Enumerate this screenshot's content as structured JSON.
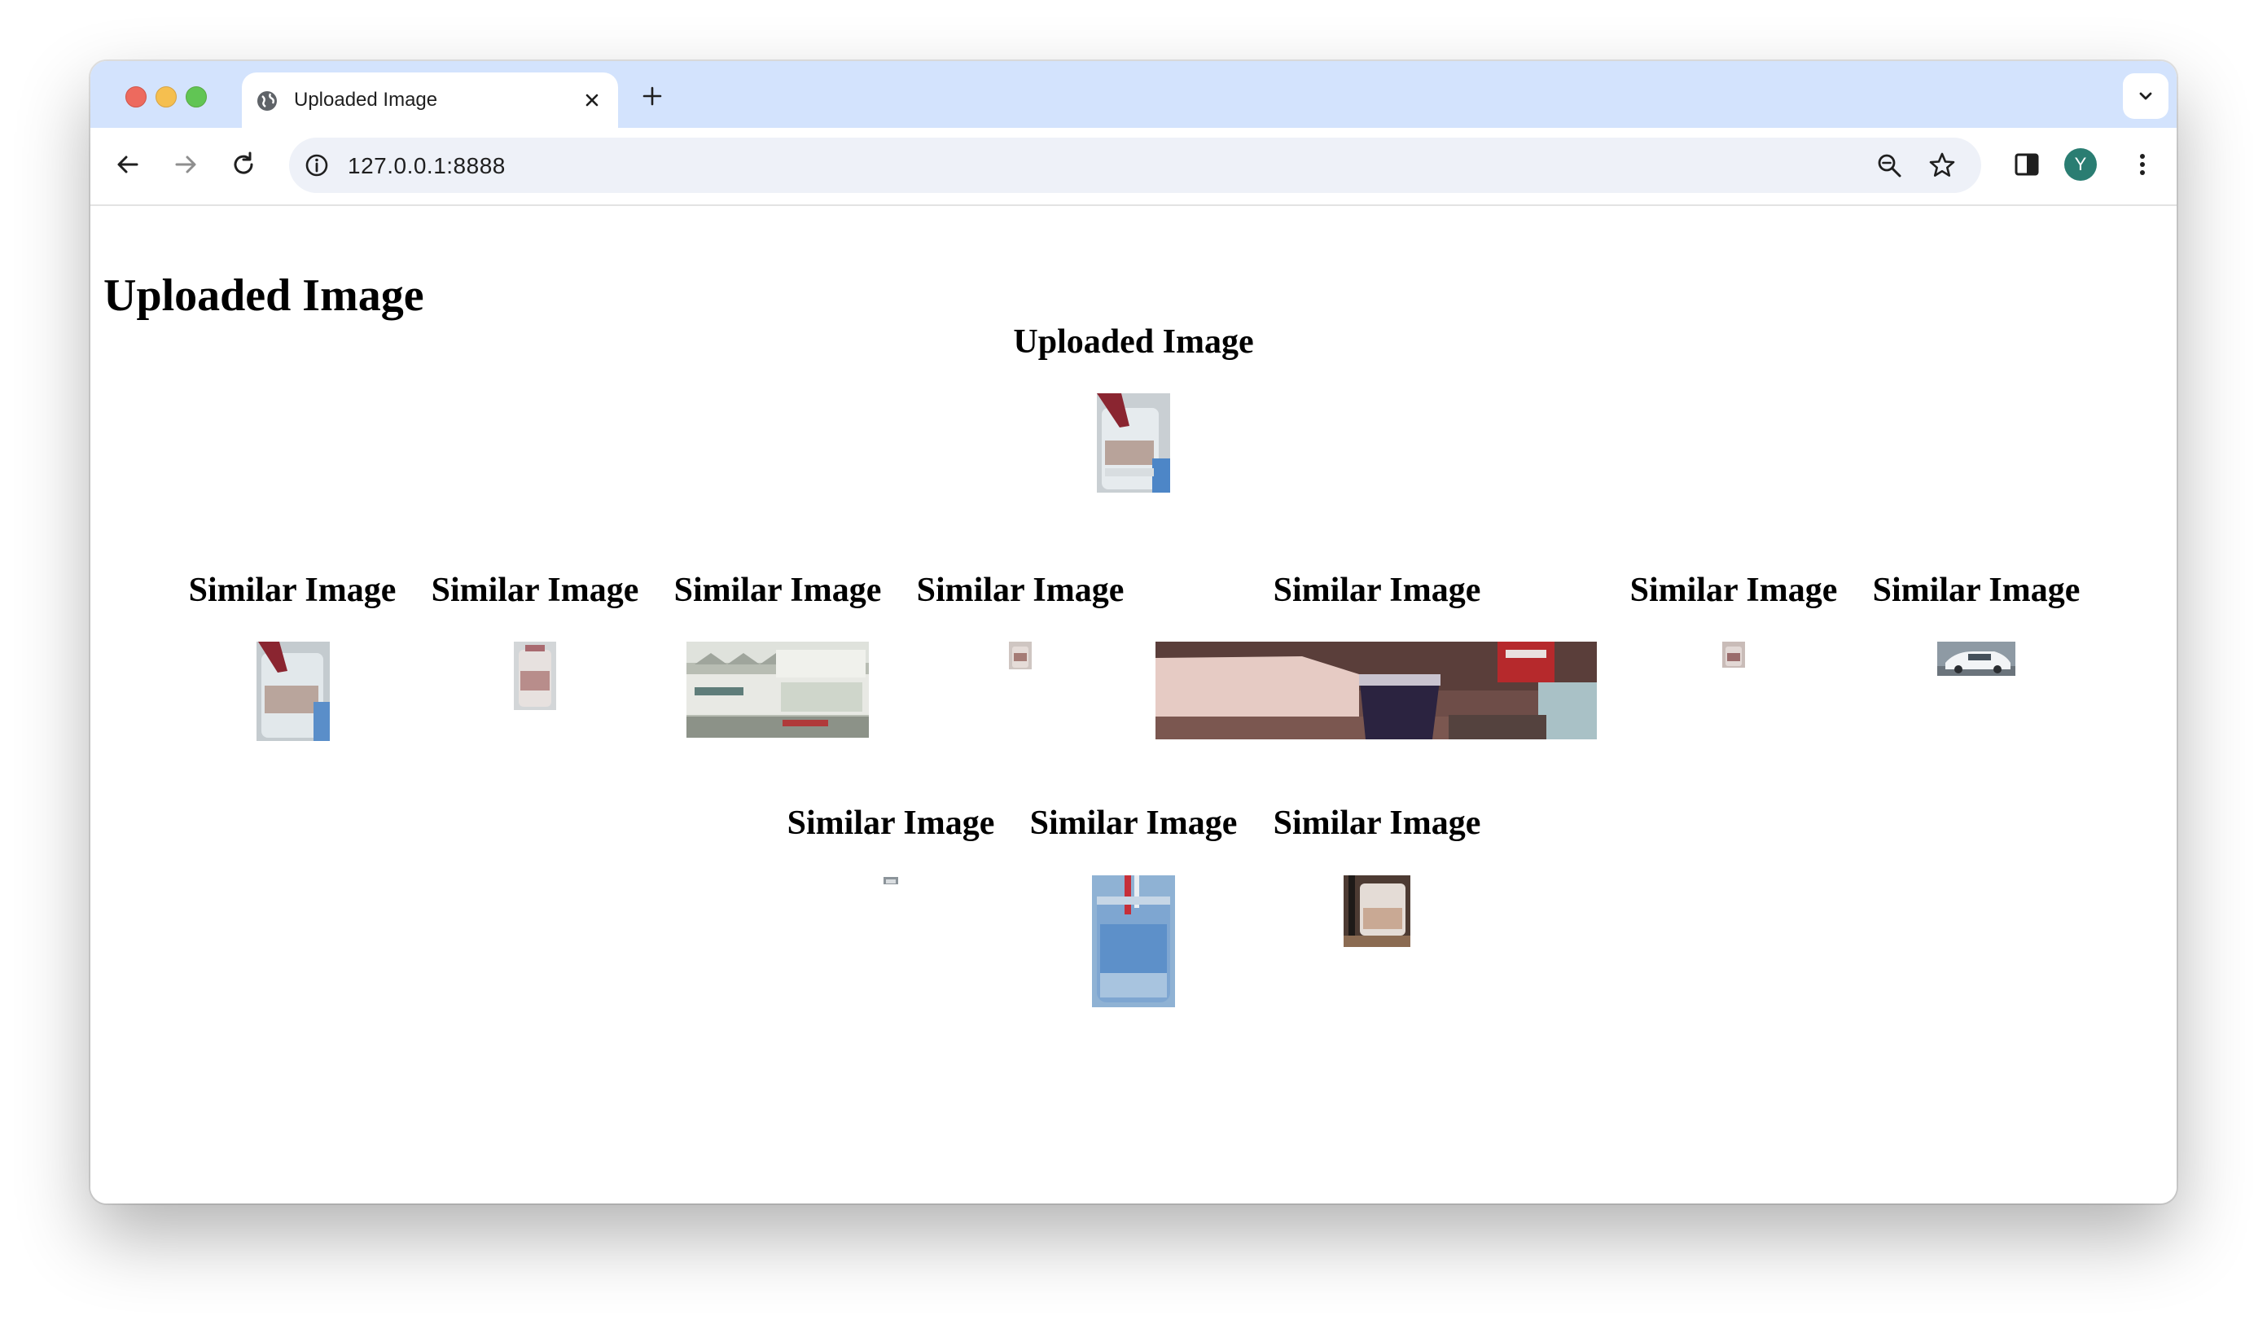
{
  "browser": {
    "tab": {
      "title": "Uploaded Image",
      "favicon": "globe-icon",
      "close_icon": "close-icon"
    },
    "new_tab_icon": "plus-icon",
    "tab_search_icon": "chevron-down-icon",
    "address_bar": {
      "url": "127.0.0.1:8888",
      "site_info_icon": "info-icon",
      "zoom_icon": "zoom-icon",
      "bookmark_icon": "star-icon"
    },
    "nav": {
      "back_icon": "back-arrow-icon",
      "forward_icon": "forward-arrow-icon",
      "reload_icon": "reload-icon"
    },
    "side_panel_icon": "side-panel-icon",
    "profile_initial": "Y",
    "profile_color": "#2a7d72",
    "menu_icon": "kebab-menu-icon",
    "tabstrip_color": "#d3e3fd"
  },
  "page": {
    "title": "Uploaded Image",
    "uploaded": {
      "heading": "Uploaded Image"
    },
    "similar_heading": "Similar Image",
    "similar_count": 10
  }
}
